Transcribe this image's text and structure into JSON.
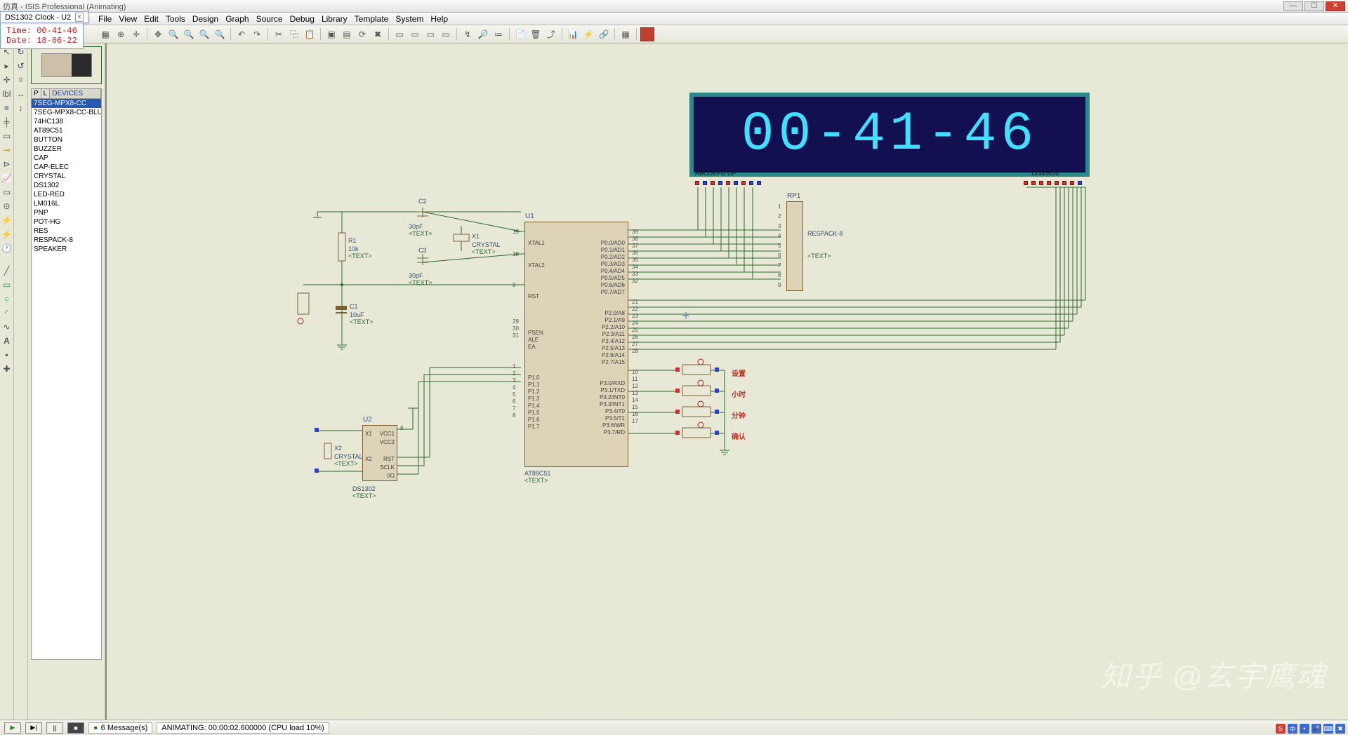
{
  "title": "仿真 - ISIS Professional (Animating)",
  "subtitle": "DS1302 Clock - U2",
  "timebox": {
    "time_label": "Time:",
    "time_value": "00-41-46",
    "date_label": "Date:",
    "date_value": "18-06-22"
  },
  "menu": [
    "File",
    "View",
    "Edit",
    "Tools",
    "Design",
    "Graph",
    "Source",
    "Debug",
    "Library",
    "Template",
    "System",
    "Help"
  ],
  "device_header": {
    "p": "P",
    "l": "L",
    "devices": "DEVICES"
  },
  "devices": [
    "7SEG-MPX8-CC",
    "7SEG-MPX8-CC-BLUE",
    "74HC138",
    "AT89C51",
    "BUTTON",
    "BUZZER",
    "CAP",
    "CAP-ELEC",
    "CRYSTAL",
    "DS1302",
    "LED-RED",
    "LM016L",
    "PNP",
    "POT-HG",
    "RES",
    "RESPACK-8",
    "SPEAKER"
  ],
  "selected_device_index": 0,
  "display": {
    "text": "00-41-46",
    "left_label": "ABCDEFG DP",
    "right_label": "12345678"
  },
  "components": {
    "U1": {
      "ref": "U1",
      "part": "AT89C51",
      "text": "<TEXT>",
      "left_pins": [
        {
          "n": "19",
          "name": "XTAL1"
        },
        {
          "n": "18",
          "name": "XTAL2"
        },
        {
          "n": "9",
          "name": "RST"
        },
        {
          "n": "29",
          "name": "PSEN"
        },
        {
          "n": "30",
          "name": "ALE"
        },
        {
          "n": "31",
          "name": "EA"
        },
        {
          "n": "1",
          "name": "P1.0"
        },
        {
          "n": "2",
          "name": "P1.1"
        },
        {
          "n": "3",
          "name": "P1.2"
        },
        {
          "n": "4",
          "name": "P1.3"
        },
        {
          "n": "5",
          "name": "P1.4"
        },
        {
          "n": "6",
          "name": "P1.5"
        },
        {
          "n": "7",
          "name": "P1.6"
        },
        {
          "n": "8",
          "name": "P1.7"
        }
      ],
      "right_pins": [
        {
          "n": "39",
          "name": "P0.0/AD0"
        },
        {
          "n": "38",
          "name": "P0.1/AD1"
        },
        {
          "n": "37",
          "name": "P0.2/AD2"
        },
        {
          "n": "36",
          "name": "P0.3/AD3"
        },
        {
          "n": "35",
          "name": "P0.4/AD4"
        },
        {
          "n": "34",
          "name": "P0.5/AD5"
        },
        {
          "n": "33",
          "name": "P0.6/AD6"
        },
        {
          "n": "32",
          "name": "P0.7/AD7"
        },
        {
          "n": "21",
          "name": "P2.0/A8"
        },
        {
          "n": "22",
          "name": "P2.1/A9"
        },
        {
          "n": "23",
          "name": "P2.2/A10"
        },
        {
          "n": "24",
          "name": "P2.3/A11"
        },
        {
          "n": "25",
          "name": "P2.4/A12"
        },
        {
          "n": "26",
          "name": "P2.5/A13"
        },
        {
          "n": "27",
          "name": "P2.6/A14"
        },
        {
          "n": "28",
          "name": "P2.7/A15"
        },
        {
          "n": "10",
          "name": "P3.0/RXD"
        },
        {
          "n": "11",
          "name": "P3.1/TXD"
        },
        {
          "n": "12",
          "name": "P3.2/INT0"
        },
        {
          "n": "13",
          "name": "P3.3/INT1"
        },
        {
          "n": "14",
          "name": "P3.4/T0"
        },
        {
          "n": "15",
          "name": "P3.5/T1"
        },
        {
          "n": "16",
          "name": "P3.6/WR"
        },
        {
          "n": "17",
          "name": "P3.7/RD"
        }
      ]
    },
    "U2": {
      "ref": "U2",
      "part": "DS1302",
      "text": "<TEXT>",
      "left_pins": [
        {
          "n": "",
          "name": "X1"
        },
        {
          "n": "",
          "name": "X2"
        }
      ],
      "right_pins": [
        {
          "n": "8",
          "name": "VCC1"
        },
        {
          "n": "",
          "name": "VCC2"
        },
        {
          "n": "",
          "name": "RST"
        },
        {
          "n": "",
          "name": "SCLK"
        },
        {
          "n": "",
          "name": "I/O"
        }
      ]
    },
    "RP1": {
      "ref": "RP1",
      "part": "RESPACK-8",
      "text": "<TEXT>",
      "pins": [
        "1",
        "2",
        "3",
        "4",
        "5",
        "6",
        "7",
        "8",
        "9"
      ]
    },
    "R1": {
      "ref": "R1",
      "value": "10k",
      "text": "<TEXT>"
    },
    "C1": {
      "ref": "C1",
      "value": "10uF",
      "text": "<TEXT>"
    },
    "C2": {
      "ref": "C2",
      "value": "30pF",
      "text": "<TEXT>"
    },
    "C3": {
      "ref": "C3",
      "value": "30pF",
      "text": "<TEXT>"
    },
    "X1": {
      "ref": "X1",
      "value": "CRYSTAL",
      "text": "<TEXT>"
    },
    "X2": {
      "ref": "X2",
      "value": "CRYSTAL",
      "text": "<TEXT>"
    }
  },
  "buttons": [
    "设置",
    "小时",
    "分钟",
    "确认"
  ],
  "status": {
    "messages": "6 Message(s)",
    "anim": "ANIMATING: 00:00:02.600000 (CPU load 10%)"
  },
  "watermark": "知乎 @玄宇鹰魂"
}
